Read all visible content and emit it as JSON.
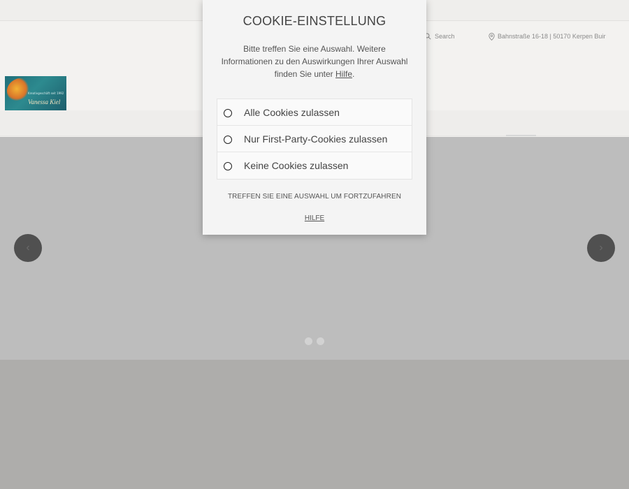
{
  "header": {
    "search_placeholder": "Search",
    "address": "Bahnstraße 16-18 | 50170 Kerpen Buir",
    "logo": {
      "tagline": "Kreativgeschäft seit 1992",
      "name": "Vanessa Kiel"
    }
  },
  "slider": {
    "prev_icon": "chevron-left-icon",
    "next_icon": "chevron-right-icon",
    "dot_count": 2
  },
  "cookie_modal": {
    "title": "COOKIE-EINSTELLUNG",
    "description_before": "Bitte treffen Sie eine Auswahl. Weitere Informationen zu den Auswirkungen Ihrer Auswahl finden Sie unter ",
    "description_link": "Hilfe",
    "description_after": ".",
    "options": [
      {
        "label": "Alle Cookies zulassen"
      },
      {
        "label": "Nur First-Party-Cookies zulassen"
      },
      {
        "label": "Keine Cookies zulassen"
      }
    ],
    "prompt": "TREFFEN SIE EINE AUSWAHL UM FORTZUFAHREN",
    "help_link": "HILFE"
  },
  "colors": {
    "modal_bg": "#f4f4f4",
    "slider_bg": "#bdbdbd",
    "arrow_bg": "#505050"
  }
}
